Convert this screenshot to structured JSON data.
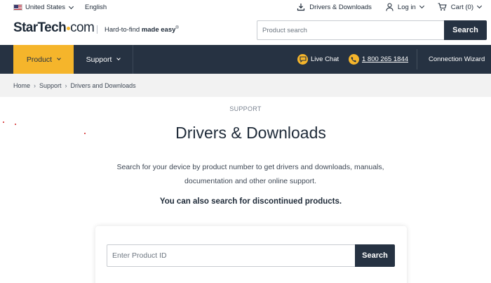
{
  "utility_bar": {
    "country": "United States",
    "language": "English",
    "drivers_downloads": "Drivers & Downloads",
    "login": "Log in",
    "cart": "Cart (0)"
  },
  "header": {
    "logo_start": "StarTech",
    "logo_end": "com",
    "tagline_regular": "Hard-to-find",
    "tagline_bold": "made easy",
    "tagline_mark": "®",
    "search_placeholder": "Product search",
    "search_button": "Search"
  },
  "nav": {
    "product": "Product",
    "support": "Support",
    "live_chat": "Live Chat",
    "phone": "1 800 265 1844",
    "connection_wizard": "Connection Wizard"
  },
  "breadcrumb": [
    "Home",
    "Support",
    "Drivers and Downloads"
  ],
  "main": {
    "eyebrow": "SUPPORT",
    "title": "Drivers & Downloads",
    "description_line1": "Search for your device by product number to get drivers and downloads, manuals,",
    "description_line2": "documentation and other online support.",
    "discontinued": "You can also search for discontinued products.",
    "product_id_placeholder": "Enter Product ID",
    "product_search_button": "Search"
  },
  "colors": {
    "navy": "#263242",
    "accent_yellow": "#f5b52b",
    "breadcrumb_bg": "#f2f2f2"
  },
  "icons": [
    "us-flag-icon",
    "chevron-down-icon",
    "download-icon",
    "user-icon",
    "cart-icon",
    "chat-icon",
    "phone-icon"
  ]
}
